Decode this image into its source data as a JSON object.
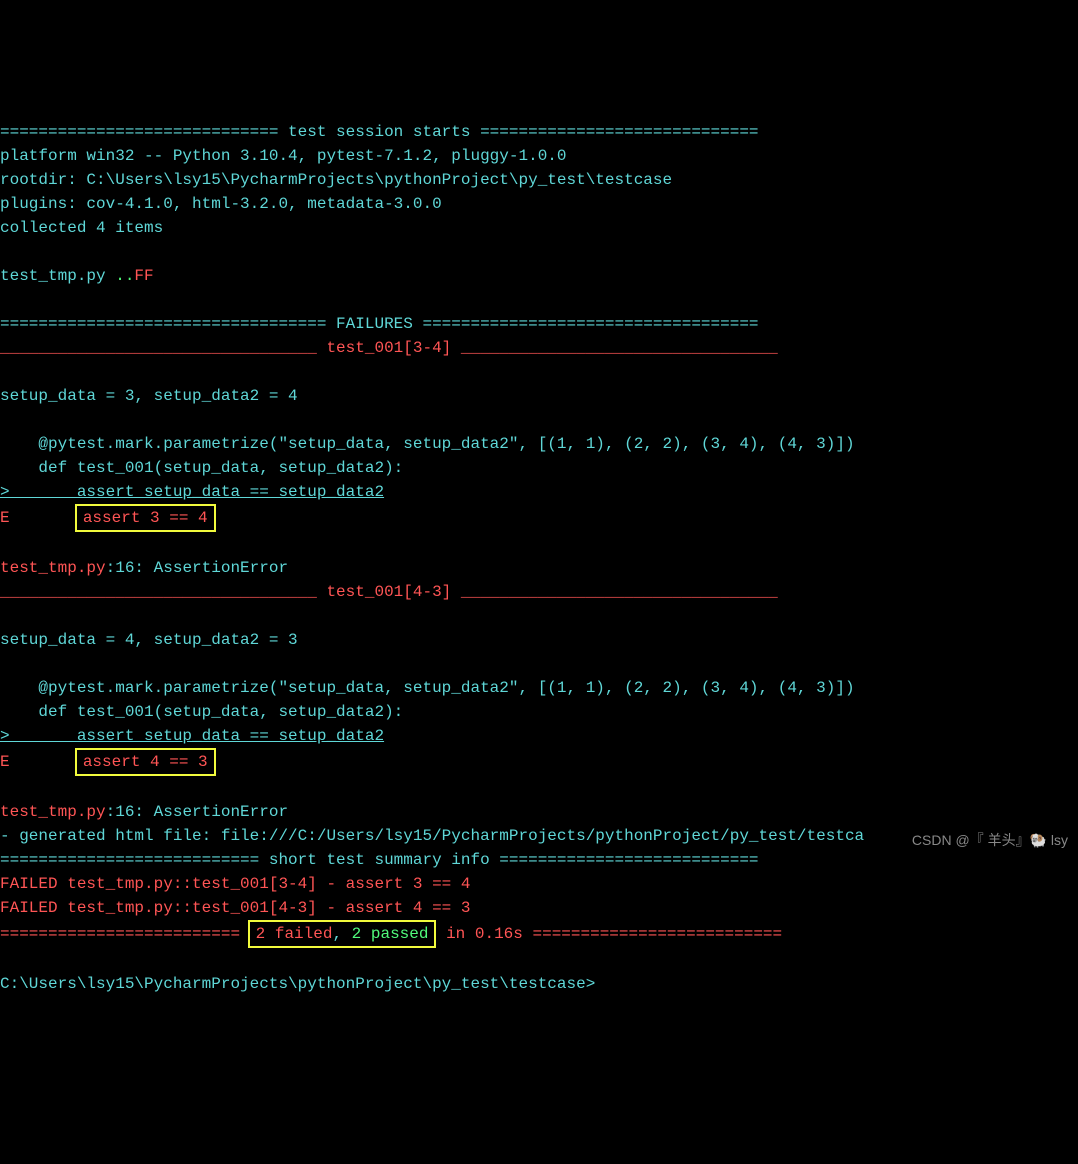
{
  "header": {
    "session_line": "============================= test session starts =============================",
    "platform": "platform win32 -- Python 3.10.4, pytest-7.1.2, pluggy-1.0.0",
    "rootdir": "rootdir: C:\\Users\\lsy15\\PycharmProjects\\pythonProject\\py_test\\testcase",
    "plugins": "plugins: cov-4.1.0, html-3.2.0, metadata-3.0.0",
    "collected": "collected 4 items"
  },
  "test_line": {
    "file": "test_tmp.py ",
    "pass": "..",
    "fail": "FF"
  },
  "failures": {
    "header": "================================== FAILURES ===================================",
    "test1": {
      "name": "_________________________________ test_001[3-4] _________________________________",
      "setup": "setup_data = 3, setup_data2 = 4",
      "decorator": "    @pytest.mark.parametrize(\"setup_data, setup_data2\", [(1, 1), (2, 2), (3, 4), (4, 3)])",
      "def": "    def test_001(setup_data, setup_data2):",
      "assert_line": ">       assert setup_data == setup_data2",
      "error_prefix": "E       ",
      "error": "assert 3 == 4",
      "location_file": "test_tmp.py",
      "location_line": ":16: AssertionError"
    },
    "test2": {
      "name": "_________________________________ test_001[4-3] _________________________________",
      "setup": "setup_data = 4, setup_data2 = 3",
      "decorator": "    @pytest.mark.parametrize(\"setup_data, setup_data2\", [(1, 1), (2, 2), (3, 4), (4, 3)])",
      "def": "    def test_001(setup_data, setup_data2):",
      "assert_line": ">       assert setup_data == setup_data2",
      "error_prefix": "E       ",
      "error": "assert 4 == 3",
      "location_file": "test_tmp.py",
      "location_line": ":16: AssertionError"
    }
  },
  "html_report": "- generated html file: file:///C:/Users/lsy15/PycharmProjects/pythonProject/py_test/testca",
  "summary": {
    "header": "=========================== short test summary info ===========================",
    "fail1": "FAILED test_tmp.py::test_001[3-4] - assert 3 == 4",
    "fail2": "FAILED test_tmp.py::test_001[4-3] - assert 4 == 3",
    "final_prefix": "========================= ",
    "failed": "2 failed",
    "comma": ", ",
    "passed": "2 passed",
    "time": " in 0.16s",
    "final_suffix": " =========================="
  },
  "prompt": "C:\\Users\\lsy15\\PycharmProjects\\pythonProject\\py_test\\testcase>",
  "watermark": "CSDN @『 羊头』🐏 lsy"
}
